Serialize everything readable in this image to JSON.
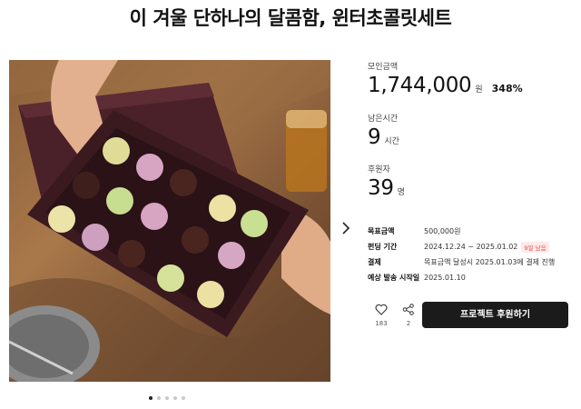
{
  "page": {
    "title": "이 겨울 단하나의 달콤함, 윈터초콜릿세트"
  },
  "funding": {
    "amount_label": "모인금액",
    "amount": "1,744,000",
    "amount_unit": "원",
    "percent": "348%",
    "time_label": "남은시간",
    "time_value": "9",
    "time_unit": "시간",
    "backers_label": "후원자",
    "backers_value": "39",
    "backers_unit": "명"
  },
  "details": {
    "rows": [
      {
        "label": "목표금액",
        "value": "500,000원"
      },
      {
        "label": "펀딩 기간",
        "value": "2024.12.24 ~ 2025.01.02",
        "badge": "9일 남음"
      },
      {
        "label": "결제",
        "value": "목표금액 달성시 2025.01.03에 결제 진행"
      },
      {
        "label": "예상 발송 시작일",
        "value": "2025.01.10"
      }
    ]
  },
  "actions": {
    "like_count": "183",
    "share_count": "2",
    "back_button": "프로젝트 후원하기"
  },
  "carousel": {
    "total": 5,
    "active": 1
  },
  "icons": [
    "heart-icon",
    "share-icon",
    "chevron-right-icon"
  ],
  "colors": {
    "button_bg": "#1b1b1b",
    "badge_text": "#e04b4b",
    "badge_bg": "#fdeaea"
  }
}
